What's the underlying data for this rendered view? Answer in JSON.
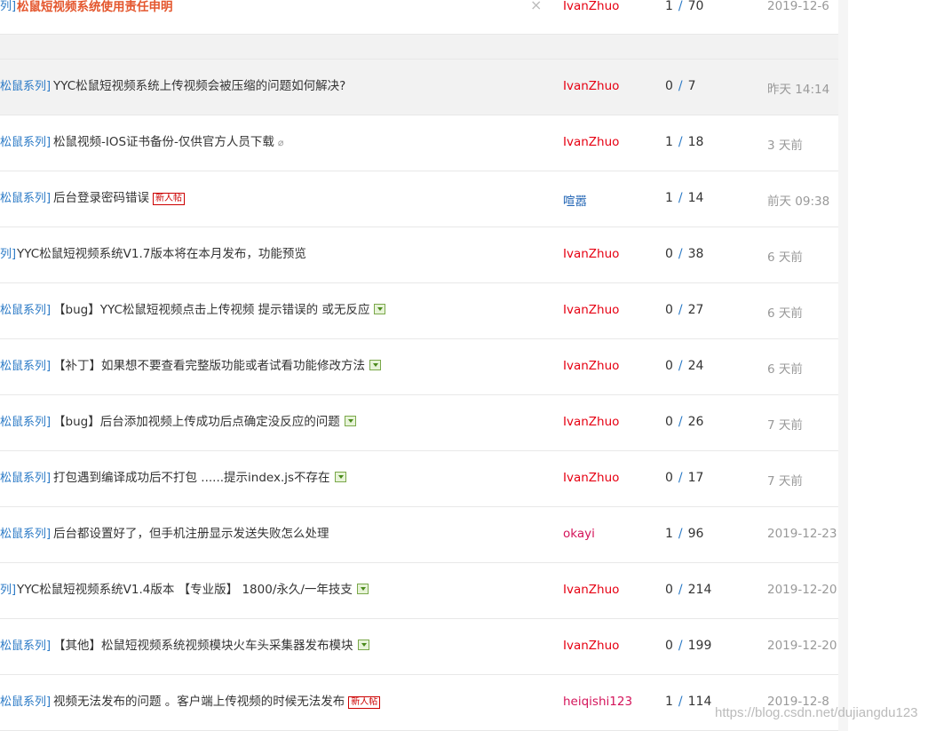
{
  "sticky": {
    "category": "列]",
    "title": "松鼠短视频系统使用责任申明",
    "author": "IvanZhuo",
    "replies": "1",
    "views": "70",
    "date": "2019-12-6",
    "close_glyph": "×"
  },
  "separator": "/",
  "threads": [
    {
      "category": "松鼠系列]",
      "title": "YYC松鼠短视频系统上传视频会被压缩的问题如何解决?",
      "attach": "",
      "author": "IvanZhuo",
      "author_color": "red",
      "replies": "0",
      "views": "7",
      "date": "昨天 14:14"
    },
    {
      "category": "松鼠系列]",
      "title": "松鼠视频-IOS证书备份-仅供官方人员下载",
      "attach": "clip",
      "author": "IvanZhuo",
      "author_color": "red",
      "replies": "1",
      "views": "18",
      "date": "3 天前"
    },
    {
      "category": "松鼠系列]",
      "title": "后台登录密码错误",
      "attach": "new",
      "author": "喧嚣",
      "author_color": "blue",
      "replies": "1",
      "views": "14",
      "date": "前天 09:38"
    },
    {
      "category": "列]",
      "title": "YYC松鼠短视频系统V1.7版本将在本月发布，功能预览",
      "attach": "",
      "author": "IvanZhuo",
      "author_color": "red",
      "replies": "0",
      "views": "38",
      "date": "6 天前"
    },
    {
      "category": "松鼠系列]",
      "title": "【bug】YYC松鼠短视频点击上传视频 提示错误的 或无反应",
      "attach": "image",
      "author": "IvanZhuo",
      "author_color": "red",
      "replies": "0",
      "views": "27",
      "date": "6 天前"
    },
    {
      "category": "松鼠系列]",
      "title": "【补丁】如果想不要查看完整版功能或者试看功能修改方法",
      "attach": "image",
      "author": "IvanZhuo",
      "author_color": "red",
      "replies": "0",
      "views": "24",
      "date": "6 天前"
    },
    {
      "category": "松鼠系列]",
      "title": "【bug】后台添加视频上传成功后点确定没反应的问题",
      "attach": "image",
      "author": "IvanZhuo",
      "author_color": "red",
      "replies": "0",
      "views": "26",
      "date": "7 天前"
    },
    {
      "category": "松鼠系列]",
      "title": "打包遇到编译成功后不打包 ......提示index.js不存在",
      "attach": "image",
      "author": "IvanZhuo",
      "author_color": "red",
      "replies": "0",
      "views": "17",
      "date": "7 天前"
    },
    {
      "category": "松鼠系列]",
      "title": "后台都设置好了，但手机注册显示发送失败怎么处理",
      "attach": "",
      "author": "okayi",
      "author_color": "pink",
      "replies": "1",
      "views": "96",
      "date": "2019-12-23"
    },
    {
      "category": "列]",
      "title": "YYC松鼠短视频系统V1.4版本 【专业版】 1800/永久/一年技支",
      "attach": "image",
      "author": "IvanZhuo",
      "author_color": "red",
      "replies": "0",
      "views": "214",
      "date": "2019-12-20"
    },
    {
      "category": "松鼠系列]",
      "title": "【其他】松鼠短视频系统视频模块火车头采集器发布模块",
      "attach": "image",
      "author": "IvanZhuo",
      "author_color": "red",
      "replies": "0",
      "views": "199",
      "date": "2019-12-20"
    },
    {
      "category": "松鼠系列]",
      "title": "视频无法发布的问题 。客户端上传视频的时候无法发布",
      "attach": "new",
      "author": "heiqishi123",
      "author_color": "pink",
      "replies": "1",
      "views": "114",
      "date": "2019-12-8"
    }
  ],
  "badge_new_label": "新人帖",
  "clip_glyph": "⌀",
  "watermark": "https://blog.csdn.net/dujiangdu123",
  "colors": {
    "category": "#2b7ac6",
    "author_red": "#e60012",
    "author_blue": "#1e62b3",
    "author_pink": "#d4145a",
    "sticky_title": "#e4572e",
    "date": "#999999"
  }
}
